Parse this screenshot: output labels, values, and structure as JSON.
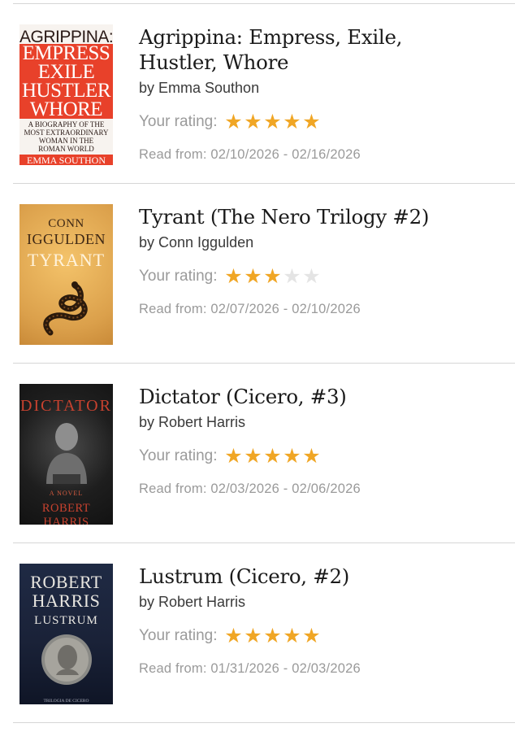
{
  "rating_label": "Your rating:",
  "star_color_on": "#f0a625",
  "star_color_off": "#e4e4e4",
  "books": [
    {
      "title_line1": "Agrippina: Empress, Exile,",
      "title_line2": "Hustler, Whore",
      "author": "by Emma Southon",
      "rating": 5,
      "dates": "Read from: 02/10/2026 - 02/16/2026",
      "cover": {
        "top": "AGRIPPINA:",
        "lines": [
          "EMPRESS",
          "EXILE",
          "HUSTLER",
          "WHORE"
        ],
        "sub": [
          "A BIOGRAPHY OF THE",
          "MOST EXTRAORDINARY",
          "WOMAN IN THE",
          "ROMAN WORLD"
        ],
        "author": "EMMA SOUTHON"
      }
    },
    {
      "title_line1": "Tyrant (The Nero Trilogy #2)",
      "title_line2": "",
      "author": "by Conn Iggulden",
      "rating": 3,
      "dates": "Read from: 02/07/2026 - 02/10/2026",
      "cover": {
        "author1": "CONN",
        "author2": "IGGULDEN",
        "title": "TYRANT"
      }
    },
    {
      "title_line1": "Dictator (Cicero, #3)",
      "title_line2": "",
      "author": "by Robert Harris",
      "rating": 5,
      "dates": "Read from: 02/03/2026 - 02/06/2026",
      "cover": {
        "title": "DICTATOR",
        "tag": "A NOVEL",
        "author": "ROBERT HARRIS"
      }
    },
    {
      "title_line1": "Lustrum (Cicero, #2)",
      "title_line2": "",
      "author": "by Robert Harris",
      "rating": 5,
      "dates": "Read from: 01/31/2026 - 02/03/2026",
      "cover": {
        "author1": "ROBERT",
        "author2": "HARRIS",
        "title": "LUSTRUM",
        "series": "TRILOGIA DE CICERO"
      }
    }
  ]
}
